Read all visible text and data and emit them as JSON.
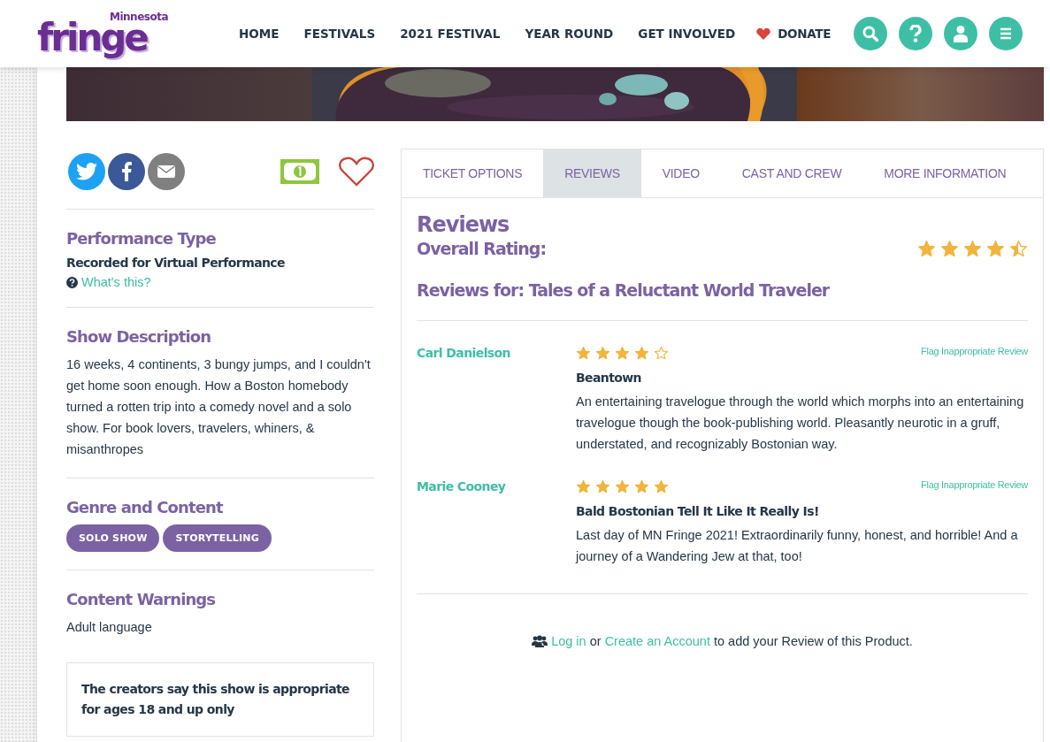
{
  "logo": {
    "small": "Minnesota",
    "big": "fringe"
  },
  "nav": [
    {
      "label": "HOME"
    },
    {
      "label": "FESTIVALS"
    },
    {
      "label": "2021 FESTIVAL"
    },
    {
      "label": "YEAR ROUND"
    },
    {
      "label": "GET INVOLVED"
    }
  ],
  "donate": "DONATE",
  "performance_type": {
    "heading": "Performance Type",
    "value": "Recorded for Virtual Performance",
    "help_link": "What's this?"
  },
  "show_description": {
    "heading": "Show Description",
    "text": "16 weeks, 4 continents, 3 bungy jumps, and I couldn't get home soon enough. How a Boston homebody turned a rotten trip into a comedy novel and a solo show. For book lovers, travelers, whiners, & misanthropes"
  },
  "genre": {
    "heading": "Genre and Content",
    "tags": [
      "SOLO SHOW",
      "STORYTELLING"
    ]
  },
  "warnings": {
    "heading": "Content Warnings",
    "text": "Adult language"
  },
  "age_notice": "The creators say this show is appropriate for ages 18 and up only",
  "tabs": [
    {
      "label": "TICKET OPTIONS",
      "selected": false
    },
    {
      "label": "REVIEWS",
      "selected": true
    },
    {
      "label": "VIDEO",
      "selected": false
    },
    {
      "label": "CAST AND CREW",
      "selected": false
    },
    {
      "label": "MORE INFORMATION",
      "selected": false
    }
  ],
  "reviews": {
    "title": "Reviews",
    "overall_label": "Overall Rating:",
    "stars": 4.5,
    "reviews_for": "Reviews for: Tales of a Reluctant World Traveler",
    "items": [
      {
        "author": "Carl Danielson",
        "stars": 4,
        "flag": "Flag Inappropriate Review",
        "title": "Beantown",
        "text": "An entertaining travelogue through the world which morphs into an entertaining travelogue though the book-publishing world. Pleasantly neurotic in a gruff, understated, and recognizably Bostonian way."
      },
      {
        "author": "Marie Cooney",
        "stars": 5,
        "flag": "Flag Inappropriate Review",
        "title": "Bald Bostonian Tell It Like It Really Is!",
        "text": "Last day of MN Fringe 2021! Extraordinarily funny, honest, and horrible! And a journey of a Wandering Jew at that, too!"
      }
    ],
    "footer": {
      "login": "Log in",
      "or": "or",
      "create": "Create an Account",
      "rest": "to add your Review of this Product."
    }
  }
}
